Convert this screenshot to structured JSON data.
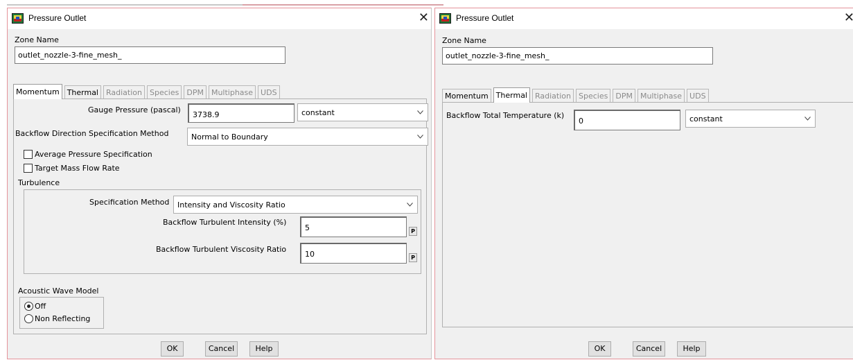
{
  "dialogs": [
    {
      "title": "Pressure Outlet",
      "close_glyph": "✕",
      "zone_name_label": "Zone Name",
      "zone_name_value": "outlet_nozzle-3-fine_mesh_",
      "tabs": [
        {
          "label": "Momentum",
          "active": true,
          "enabled": true
        },
        {
          "label": "Thermal",
          "active": false,
          "enabled": true
        },
        {
          "label": "Radiation",
          "active": false,
          "enabled": false
        },
        {
          "label": "Species",
          "active": false,
          "enabled": false
        },
        {
          "label": "DPM",
          "active": false,
          "enabled": false
        },
        {
          "label": "Multiphase",
          "active": false,
          "enabled": false
        },
        {
          "label": "UDS",
          "active": false,
          "enabled": false
        }
      ],
      "momentum": {
        "gauge_pressure_label": "Gauge Pressure (pascal)",
        "gauge_pressure_value": "3738.9",
        "gauge_pressure_profile": "constant",
        "backflow_direction_label": "Backflow Direction Specification Method",
        "backflow_direction_value": "Normal to Boundary",
        "avg_pressure_label": "Average Pressure Specification",
        "target_mass_label": "Target Mass Flow Rate",
        "turbulence_label": "Turbulence",
        "spec_method_label": "Specification Method",
        "spec_method_value": "Intensity and Viscosity Ratio",
        "turb_intensity_label": "Backflow Turbulent Intensity (%)",
        "turb_intensity_value": "5",
        "turb_viscosity_label": "Backflow Turbulent Viscosity Ratio",
        "turb_viscosity_value": "10",
        "p_button": "P",
        "acoustic_label": "Acoustic Wave Model",
        "acoustic_off": "Off",
        "acoustic_nonreflecting": "Non Reflecting"
      },
      "buttons": {
        "ok": "OK",
        "cancel": "Cancel",
        "help": "Help"
      }
    },
    {
      "title": "Pressure Outlet",
      "close_glyph": "✕",
      "zone_name_label": "Zone Name",
      "zone_name_value": "outlet_nozzle-3-fine_mesh_",
      "tabs": [
        {
          "label": "Momentum",
          "active": false,
          "enabled": true
        },
        {
          "label": "Thermal",
          "active": true,
          "enabled": true
        },
        {
          "label": "Radiation",
          "active": false,
          "enabled": false
        },
        {
          "label": "Species",
          "active": false,
          "enabled": false
        },
        {
          "label": "DPM",
          "active": false,
          "enabled": false
        },
        {
          "label": "Multiphase",
          "active": false,
          "enabled": false
        },
        {
          "label": "UDS",
          "active": false,
          "enabled": false
        }
      ],
      "thermal": {
        "backflow_temp_label": "Backflow Total Temperature (k)",
        "backflow_temp_value": "0",
        "backflow_temp_profile": "constant"
      },
      "buttons": {
        "ok": "OK",
        "cancel": "Cancel",
        "help": "Help"
      }
    }
  ]
}
